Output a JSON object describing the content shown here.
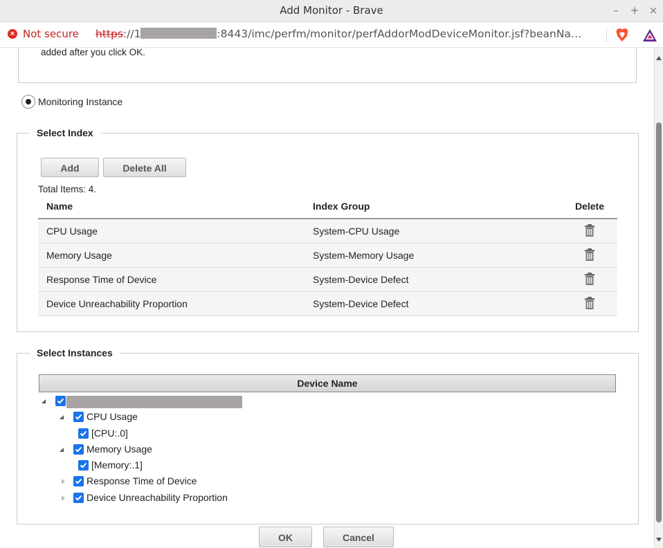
{
  "window": {
    "title": "Add Monitor - Brave"
  },
  "urlbar": {
    "security_label": "Not secure",
    "scheme": "https",
    "url_prefix": "://1",
    "url_rest": ":8443/imc/perfm/monitor/perfAddorModDeviceMonitor.jsf?beanNa…"
  },
  "note": {
    "text": "Please select devices and indexes as needed. If you select too many instances, the page might not respond or the monitor might fail to be added after you click OK."
  },
  "mode": {
    "label": "Monitoring Instance",
    "selected": true
  },
  "select_index": {
    "legend": "Select Index",
    "add_label": "Add",
    "delete_all_label": "Delete All",
    "total_label": "Total Items: 4.",
    "columns": [
      "Name",
      "Index Group",
      "Delete"
    ],
    "rows": [
      {
        "name": "CPU Usage",
        "group": "System-CPU Usage",
        "icon": "trash-icon"
      },
      {
        "name": "Memory Usage",
        "group": "System-Memory Usage",
        "icon": "trash-icon"
      },
      {
        "name": "Response Time of Device",
        "group": "System-Device Defect",
        "icon": "trash-icon"
      },
      {
        "name": "Device Unreachability Proportion",
        "group": "System-Device Defect",
        "icon": "trash-icon"
      }
    ]
  },
  "select_instances": {
    "legend": "Select Instances",
    "column": "Device Name",
    "tree": {
      "children": [
        {
          "label": "CPU Usage",
          "expanded": true,
          "checked": true,
          "children": [
            {
              "label": "[CPU:.0]",
              "checked": true
            }
          ]
        },
        {
          "label": "Memory Usage",
          "expanded": true,
          "checked": true,
          "children": [
            {
              "label": "[Memory:.1]",
              "checked": true
            }
          ]
        },
        {
          "label": "Response Time of Device",
          "expanded": false,
          "checked": true
        },
        {
          "label": "Device Unreachability Proportion",
          "expanded": false,
          "checked": true
        }
      ]
    }
  },
  "footer": {
    "ok_label": "OK",
    "cancel_label": "Cancel"
  },
  "colors": {
    "checkbox": "#1a73e8",
    "insecure": "#c5221f",
    "brave": "#fb542b"
  }
}
